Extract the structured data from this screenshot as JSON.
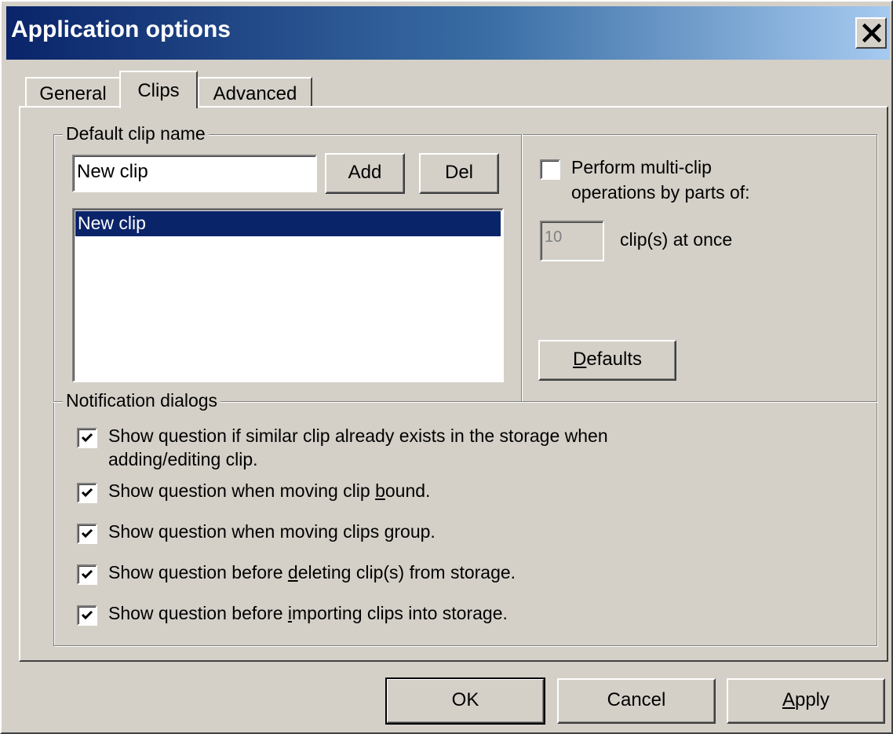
{
  "window": {
    "title": "Application options",
    "close_label": "X"
  },
  "tabs": [
    {
      "label": "General",
      "active": false
    },
    {
      "label": "Clips",
      "active": true
    },
    {
      "label": "Advanced",
      "active": false
    }
  ],
  "clip_name": {
    "legend": "Default clip name",
    "input_value": "New clip",
    "add_label": "Add",
    "del_label": "Del",
    "list_items": [
      "New clip"
    ],
    "selected_index": 0
  },
  "multi_clip": {
    "checkbox_checked": false,
    "label_line1": "Perform multi-clip",
    "label_line2": "operations by parts of:",
    "count_value": "10",
    "count_suffix": "clip(s) at once",
    "defaults_label": "Defaults"
  },
  "notifications": {
    "legend": "Notification dialogs",
    "items": [
      {
        "line1": "Show question if similar clip already exists in the storage when",
        "line2": "adding/editing clip.",
        "checked": true
      },
      {
        "pre": "Show question when moving clip ",
        "mn": "b",
        "post": "ound.",
        "checked": true
      },
      {
        "pre": "Show question when moving clips ",
        "mn": "g",
        "post": "roup.",
        "checked": true
      },
      {
        "pre": "Show question before ",
        "mn": "d",
        "post": "eleting clip(s) from storage.",
        "checked": true
      },
      {
        "pre": "Show question before ",
        "mn": "i",
        "post": "mporting clips into storage.",
        "checked": true
      }
    ]
  },
  "footer": {
    "ok_label": "OK",
    "cancel_label": "Cancel",
    "apply_label": "Apply"
  },
  "colors": {
    "title_gradient_start": "#0a246a",
    "title_gradient_end": "#a6caf0",
    "face": "#d4d0c8",
    "selection": "#0a246a"
  }
}
